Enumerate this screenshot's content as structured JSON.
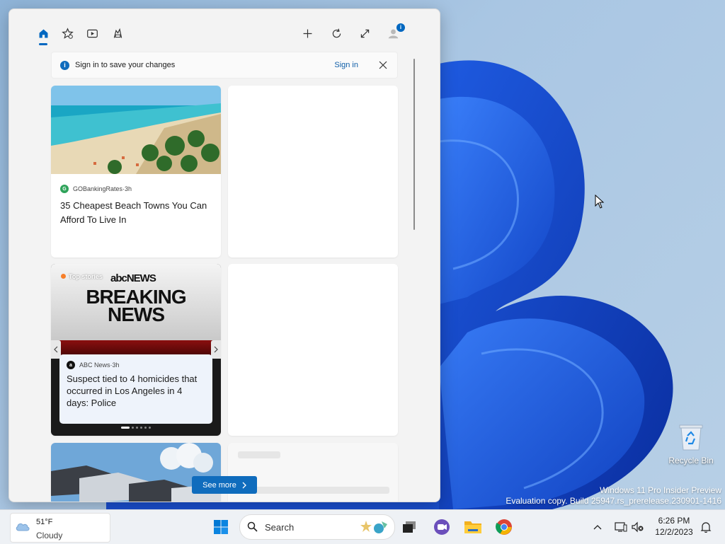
{
  "desktop": {
    "icons": [
      {
        "label": "Recycle Bin"
      }
    ],
    "watermark_line1": "Windows 11 Pro Insider Preview",
    "watermark_line2": "Evaluation copy. Build 25947.rs_prerelease.230901-1416"
  },
  "widgets": {
    "toolbar_icons": [
      "home-icon",
      "star-icon",
      "play-icon",
      "game-icon",
      "add-icon",
      "refresh-icon",
      "expand-icon",
      "profile-icon"
    ],
    "profile_badge": "i",
    "signin_banner": {
      "message": "Sign in to save your changes",
      "link": "Sign in",
      "info_glyph": "i"
    },
    "cards": [
      {
        "source": "GOBankingRates",
        "time": "3h",
        "sep": " · ",
        "headline": "35 Cheapest Beach Towns You Can Afford To Live In"
      },
      {
        "tag": "Top stories",
        "image_brand": "abcNEWS",
        "image_line1": "BREAKING",
        "image_line2": "NEWS",
        "source": "ABC News",
        "time": "3h",
        "sep": " · ",
        "headline": "Suspect tied to 4 homicides that occurred in Los Angeles in 4 days: Police",
        "carousel_count": 6,
        "carousel_active": 1
      }
    ],
    "see_more": "See more",
    "src1_logo": "G",
    "src2_logo": "a"
  },
  "taskbar": {
    "weather": {
      "temp": "51°F",
      "condition": "Cloudy"
    },
    "search_placeholder": "Search",
    "clock": {
      "time": "6:26 PM",
      "date": "12/2/2023"
    }
  }
}
